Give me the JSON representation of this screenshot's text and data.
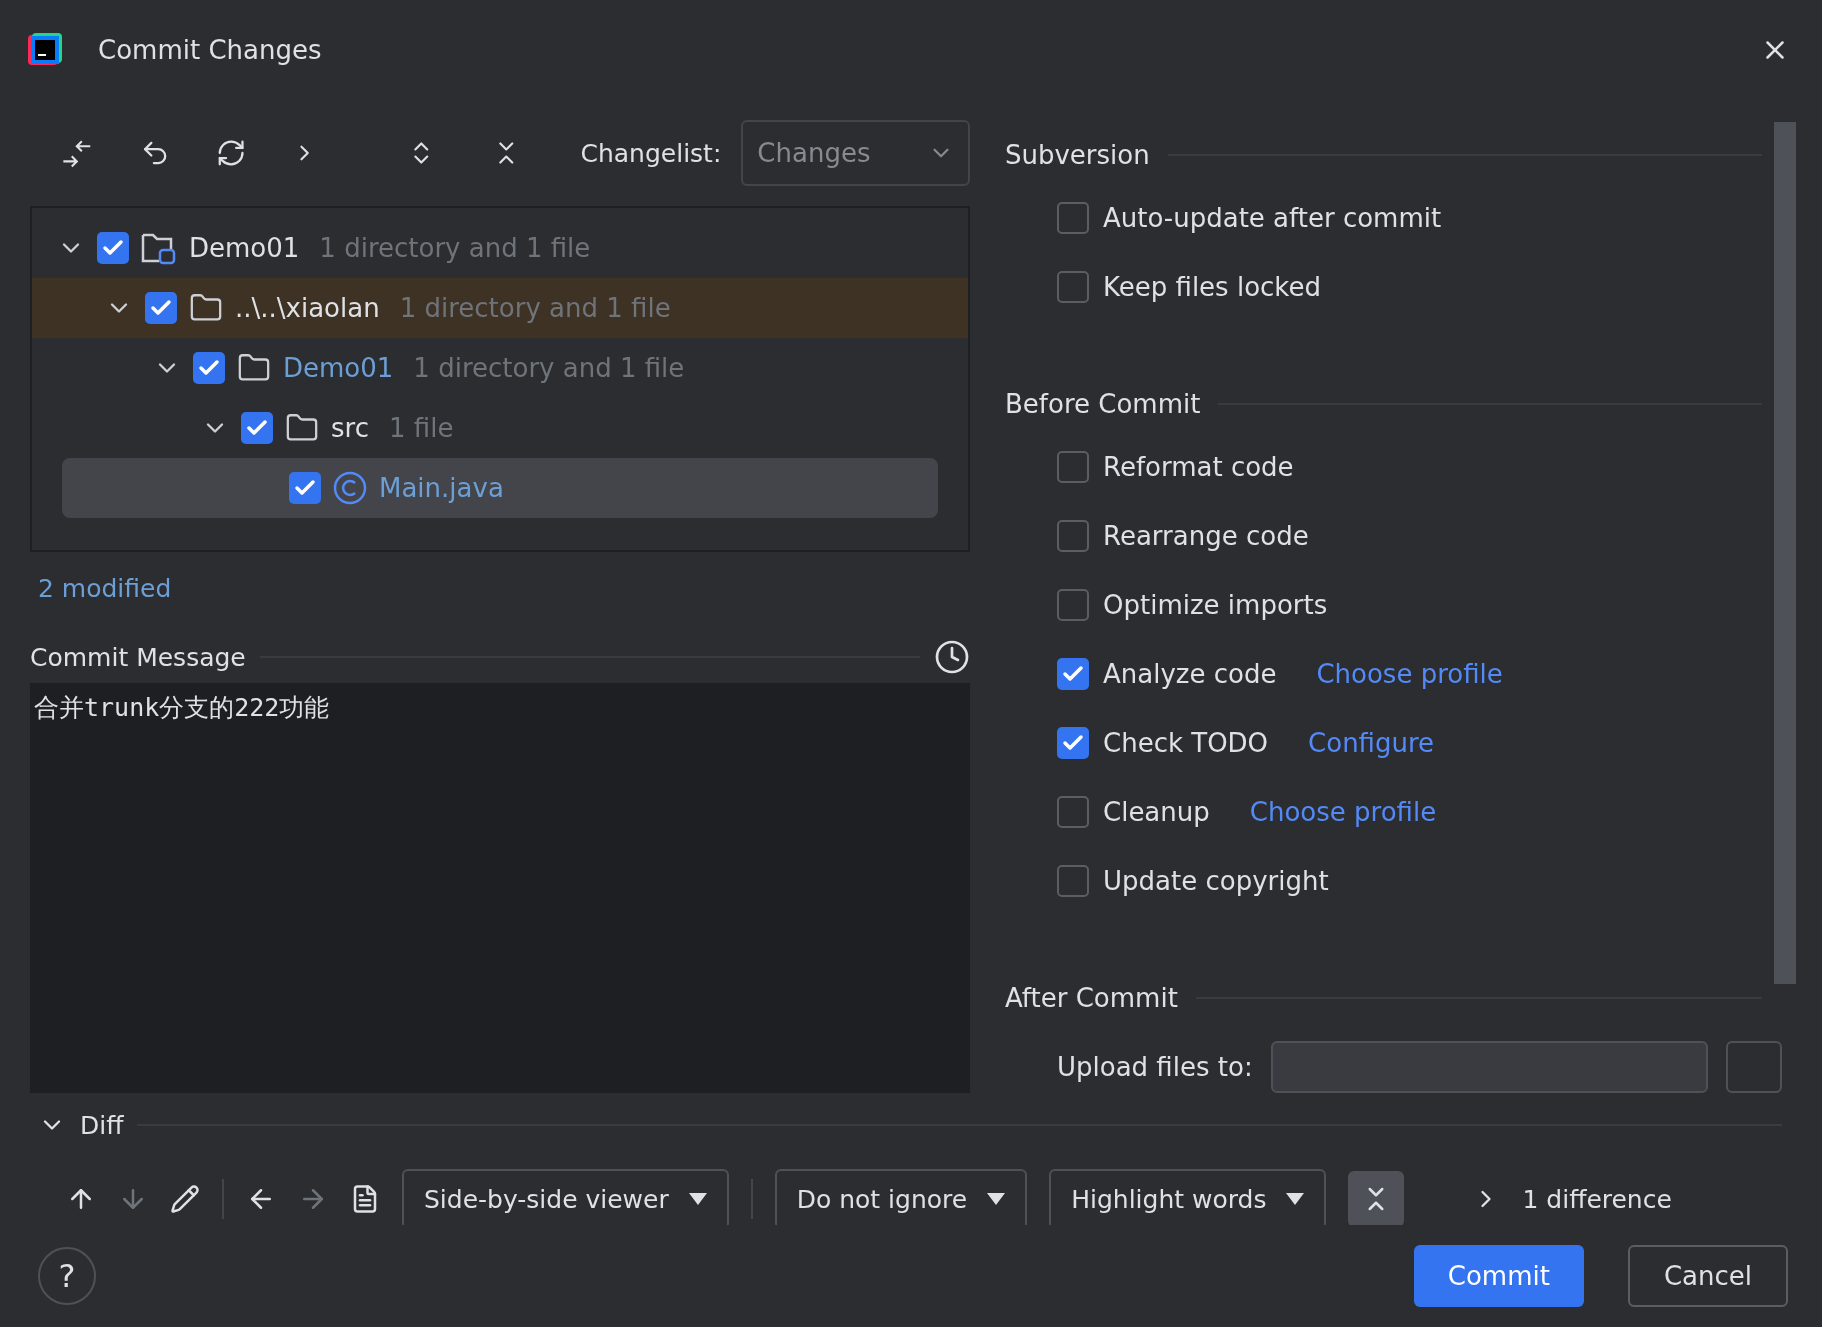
{
  "window": {
    "title": "Commit Changes"
  },
  "toolbar": {
    "changelist_label": "Changelist:",
    "changelist_value": "Changes"
  },
  "tree": [
    {
      "name": "Demo01",
      "detail": "1 directory and 1 file",
      "kind": "module",
      "checked": true,
      "expanded": true,
      "highlighted": false,
      "selected": false,
      "modified": false,
      "children": [
        {
          "name": "..\\..\\xiaolan",
          "detail": "1 directory and 1 file",
          "kind": "folder",
          "checked": true,
          "expanded": true,
          "highlighted": true,
          "selected": false,
          "modified": false,
          "children": [
            {
              "name": "Demo01",
              "detail": "1 directory and 1 file",
              "kind": "folder",
              "checked": true,
              "expanded": true,
              "highlighted": false,
              "selected": false,
              "modified": true,
              "children": [
                {
                  "name": "src",
                  "detail": "1 file",
                  "kind": "folder",
                  "checked": true,
                  "expanded": true,
                  "highlighted": false,
                  "selected": false,
                  "modified": false,
                  "children": [
                    {
                      "name": "Main.java",
                      "kind": "class",
                      "checked": true,
                      "selected": true,
                      "modified": true
                    }
                  ]
                }
              ]
            }
          ]
        }
      ]
    }
  ],
  "summary": "2 modified",
  "commit_message": {
    "label": "Commit Message",
    "value": "合并trunk分支的222功能"
  },
  "sections": [
    {
      "title": "Subversion",
      "options": [
        {
          "label": "Auto-update after commit",
          "checked": false
        },
        {
          "label": "Keep files locked",
          "checked": false
        }
      ]
    },
    {
      "title": "Before Commit",
      "options": [
        {
          "label": "Reformat code",
          "checked": false
        },
        {
          "label": "Rearrange code",
          "checked": false
        },
        {
          "label": "Optimize imports",
          "checked": false
        },
        {
          "label": "Analyze code",
          "checked": true,
          "link": "Choose profile"
        },
        {
          "label": "Check TODO",
          "checked": true,
          "link": "Configure"
        },
        {
          "label": "Cleanup",
          "checked": false,
          "link": "Choose profile"
        },
        {
          "label": "Update copyright",
          "checked": false
        }
      ]
    },
    {
      "title": "After Commit",
      "fields": [
        {
          "label": "Upload files to:"
        }
      ]
    }
  ],
  "diff": {
    "title": "Diff",
    "expanded": true,
    "dropdowns": [
      "Side-by-side viewer",
      "Do not ignore",
      "Highlight words"
    ],
    "count": "1 difference"
  },
  "buttons": {
    "help": "?",
    "commit": "Commit",
    "cancel": "Cancel"
  }
}
